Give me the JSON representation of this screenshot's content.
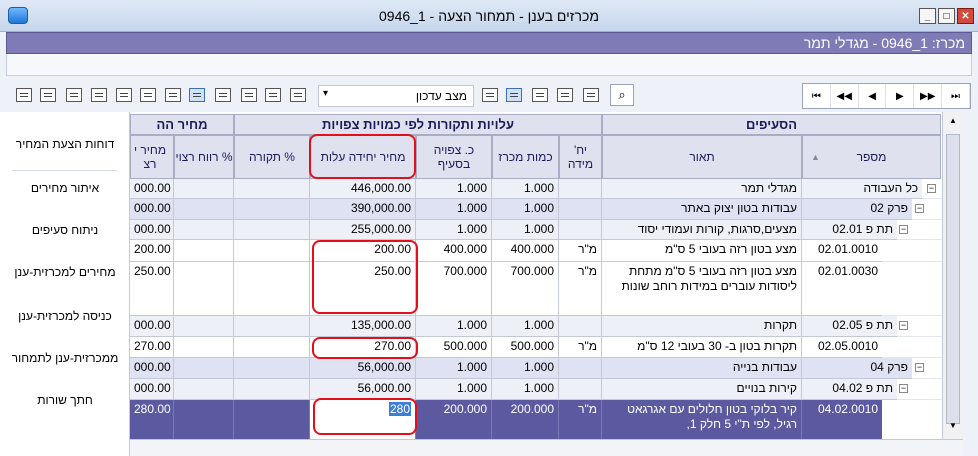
{
  "window": {
    "title": "מכרזים בענן - תמחור הצעה - 1_0946"
  },
  "header_bar": {
    "text": "מכרז: 1_0946 - מגדלי תמר"
  },
  "toolbar": {
    "status_value": "מצב עדכון",
    "icons": [
      "print-icon",
      "preview-icon",
      "report-icon",
      "excel-icon",
      "tree-expand-icon",
      "tree-icon",
      "tree-collapse-icon",
      "indent-icon",
      "copy-icon",
      "new-doc-icon",
      "columns-icon",
      "table-icon"
    ],
    "right_icons": [
      "list-icon",
      "filter-icon",
      "save-icon",
      "undo-icon",
      "refresh-icon"
    ],
    "nav": [
      "first-icon",
      "prev-page-icon",
      "prev-icon",
      "next-icon",
      "next-page-icon",
      "last-icon"
    ]
  },
  "left_panel": {
    "items": [
      "דוחות הצעת המחיר",
      "איתור מחירים",
      "ניתוח סעיפים",
      "מחירים למכרזית-ענן",
      "כניסה למכרזית-ענן",
      "ממכרזית-ענן לתמחור",
      "חתך שורות"
    ]
  },
  "grid": {
    "group_headers": {
      "items": "הסעיפים",
      "costs": "עלויות ותקורות לפי כמויות צפויות",
      "price": "מחיר הה"
    },
    "columns": {
      "number": "מספר",
      "description": "תאור",
      "unit": "יח' מידה",
      "qty_tender": "כמות מכרז",
      "qty_expected": "כ. צפויה בסעיף",
      "unit_cost": "מחיר יחידה עלות",
      "overhead_pct": "% תקורה",
      "profit_pct": "% רווח רצוי",
      "price_partial": "מחיר י רצ"
    },
    "rows": [
      {
        "number": "כל העבודה",
        "description": "מגדלי תמר",
        "unit": "",
        "qty_tender": "1.000",
        "qty_expected": "1.000",
        "unit_cost": "446,000.00",
        "overhead": "",
        "profit": "",
        "price": "000.00",
        "style": "sum"
      },
      {
        "number": "פרק 02",
        "description": "עבודות בטון יצוק באתר",
        "unit": "",
        "qty_tender": "1.000",
        "qty_expected": "1.000",
        "unit_cost": "390,000.00",
        "overhead": "",
        "profit": "",
        "price": "000.00",
        "style": "sum2"
      },
      {
        "number": "תת פ 02.01",
        "description": "מצעים,סרגות, קורות ועמודי יסוד",
        "unit": "",
        "qty_tender": "1.000",
        "qty_expected": "1.000",
        "unit_cost": "255,000.00",
        "overhead": "",
        "profit": "",
        "price": "000.00",
        "style": "sum"
      },
      {
        "number": "02.01.0010",
        "description": "מצע בטון רזה בעובי 5 ס\"מ",
        "unit": "מ\"ר",
        "qty_tender": "400.000",
        "qty_expected": "400.000",
        "unit_cost": "200.00",
        "overhead": "",
        "profit": "",
        "price": "200.00",
        "style": ""
      },
      {
        "number": "02.01.0030",
        "description": "מצע בטון רזה בעובי 5 ס\"מ מתחת ליסודות עוברים במידות רוחב שונות",
        "unit": "מ\"ר",
        "qty_tender": "700.000",
        "qty_expected": "700.000",
        "unit_cost": "250.00",
        "overhead": "",
        "profit": "",
        "price": "250.00",
        "style": ""
      },
      {
        "number": "תת פ 02.05",
        "description": "תקרות",
        "unit": "",
        "qty_tender": "1.000",
        "qty_expected": "1.000",
        "unit_cost": "135,000.00",
        "overhead": "",
        "profit": "",
        "price": "000.00",
        "style": "sum"
      },
      {
        "number": "02.05.0010",
        "description": "תקרות בטון ב- 30 בעובי 12 ס\"מ",
        "unit": "מ\"ר",
        "qty_tender": "500.000",
        "qty_expected": "500.000",
        "unit_cost": "270.00",
        "overhead": "",
        "profit": "",
        "price": "270.00",
        "style": ""
      },
      {
        "number": "פרק 04",
        "description": "עבודות בנייה",
        "unit": "",
        "qty_tender": "1.000",
        "qty_expected": "1.000",
        "unit_cost": "56,000.00",
        "overhead": "",
        "profit": "",
        "price": "000.00",
        "style": "sum2"
      },
      {
        "number": "תת פ 04.02",
        "description": "קירות בנויים",
        "unit": "",
        "qty_tender": "1.000",
        "qty_expected": "1.000",
        "unit_cost": "56,000.00",
        "overhead": "",
        "profit": "",
        "price": "000.00",
        "style": "sum"
      },
      {
        "number": "04.02.0010",
        "description": "קיר בלוקי בטון חלולים עם אגרגאט רגיל, לפי ת\"י 5 חלק 1,",
        "unit": "מ\"ר",
        "qty_tender": "200.000",
        "qty_expected": "200.000",
        "unit_cost": "280",
        "overhead": "",
        "profit": "",
        "price": "280.00",
        "style": "sel"
      }
    ]
  },
  "colors": {
    "accent": "#7e7bb6",
    "selected": "#5b5aa0",
    "highlight": "#e3101b"
  }
}
